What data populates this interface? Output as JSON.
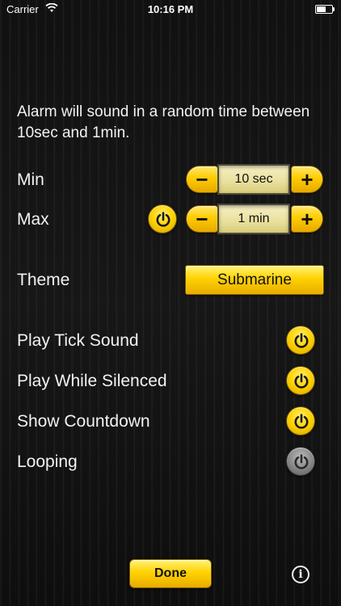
{
  "status_bar": {
    "carrier": "Carrier",
    "time": "10:16 PM"
  },
  "description": "Alarm will sound in a random time between 10sec and 1min.",
  "min": {
    "label": "Min",
    "minus": "−",
    "value": "10 sec",
    "plus": "+"
  },
  "max": {
    "label": "Max",
    "minus": "−",
    "value": "1 min",
    "plus": "+",
    "toggle_on": true
  },
  "theme": {
    "label": "Theme",
    "value": "Submarine"
  },
  "options": [
    {
      "label": "Play Tick Sound",
      "on": true
    },
    {
      "label": "Play While Silenced",
      "on": true
    },
    {
      "label": "Show Countdown",
      "on": true
    },
    {
      "label": "Looping",
      "on": false
    }
  ],
  "footer": {
    "done_label": "Done",
    "info_glyph": "i"
  },
  "colors": {
    "accent_yellow": "#ffd200",
    "toggle_off_gray": "#8e8e8e",
    "background": "#111111"
  },
  "icons": {
    "toggle": "power-icon",
    "info": "info-icon",
    "wifi": "wifi-icon",
    "battery": "battery-icon"
  }
}
